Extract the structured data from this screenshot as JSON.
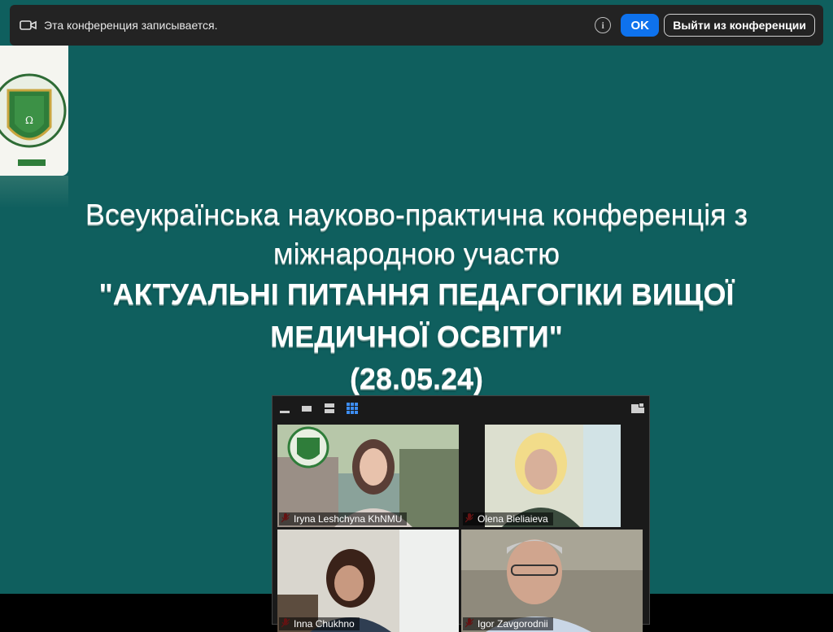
{
  "notification": {
    "message": "Эта конференция записывается.",
    "ok_label": "OK",
    "leave_label": "Выйти из конференции",
    "info_glyph": "i"
  },
  "slide": {
    "line1": "Всеукраїнська науково-практична конференція з",
    "line2": "міжнародною участю",
    "line3": "\"АКТУАЛЬНІ ПИТАННЯ ПЕДАГОГІКИ ВИЩОЇ",
    "line4": "МЕДИЧНОЇ ОСВІТИ\"",
    "line5": "(28.05.24)",
    "background_color": "#0f5f5e"
  },
  "gallery": {
    "participants": [
      {
        "name": "Iryna Leshchyna KhNMU",
        "muted": true
      },
      {
        "name": "Olena Bieliaieva",
        "muted": true
      },
      {
        "name": "Inna Chukhno",
        "muted": true
      },
      {
        "name": "Igor Zavgorodnii",
        "muted": true
      }
    ]
  },
  "colors": {
    "accent": "#0e72ed",
    "toast_bg": "#232323",
    "muted_mic": "#e02828"
  }
}
